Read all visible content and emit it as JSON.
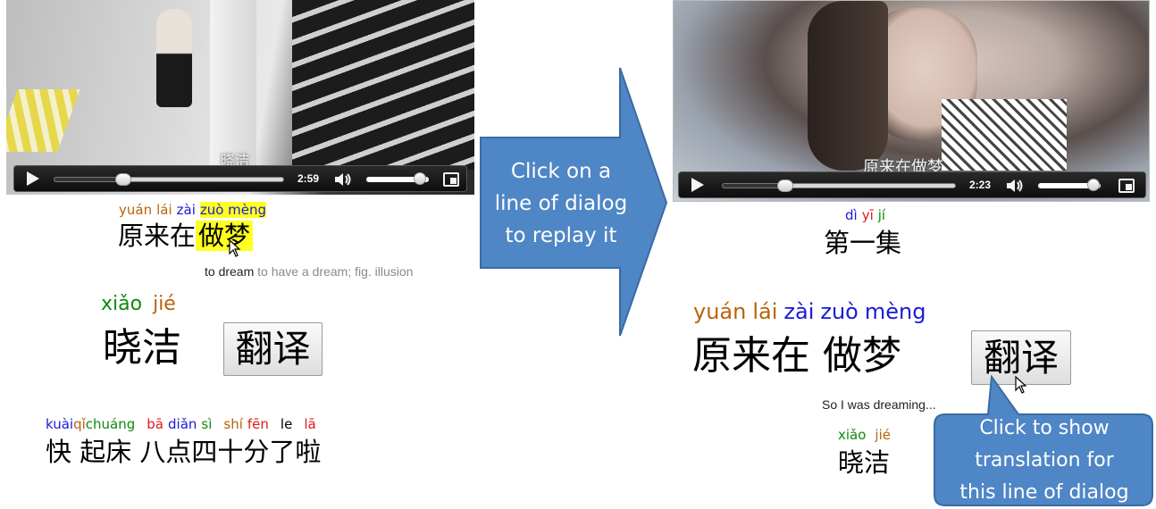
{
  "colors": {
    "pinyin_tone_1": "#b8640a",
    "pinyin_tone_2": "#0e8a0e",
    "pinyin_tone_3": "#1a1ad8",
    "pinyin_tone_4": "#e01818",
    "highlight": "#ffff22",
    "callout_fill": "#4f86c6",
    "callout_stroke": "#3a6ba3"
  },
  "left_panel": {
    "video": {
      "subtitle": "晓洁",
      "time": "2:59",
      "progress": 0.3,
      "volume": 0.85,
      "icons": [
        "play-icon",
        "volume-icon",
        "fullscreen-icon"
      ]
    },
    "line1": {
      "pinyin": [
        "yuán",
        "lái",
        "zài",
        "zuò mèng"
      ],
      "hanzi": [
        "原来在",
        "做梦"
      ],
      "highlighted_word": "做梦",
      "gloss_word": "to dream",
      "gloss_rest": "to have a dream; fig. illusion"
    },
    "line2": {
      "pinyin": [
        "xiǎo",
        "jié"
      ],
      "hanzi": "晓洁",
      "translate_button": "翻译"
    },
    "line3": {
      "pinyin": [
        "kuài",
        "qǐ",
        "chuáng",
        "bā",
        "diǎn",
        "sì",
        "shí",
        "fēn",
        "le",
        "lā"
      ],
      "hanzi": "快 起床 八点四十分了啦"
    }
  },
  "arrow_callout": {
    "text_line1": "Click on a",
    "text_line2": "line of dialog",
    "text_line3": "to replay it"
  },
  "right_panel": {
    "video": {
      "subtitle": "原来在做梦",
      "time": "2:23",
      "progress": 0.27,
      "volume": 0.88,
      "icons": [
        "play-icon",
        "volume-icon",
        "fullscreen-icon"
      ]
    },
    "episode": {
      "pinyin": [
        "dì",
        "yī",
        "jí"
      ],
      "hanzi": "第一集"
    },
    "line1": {
      "pinyin": [
        "yuán",
        "lái",
        "zài",
        "zuò",
        "mèng"
      ],
      "hanzi": "原来在 做梦",
      "translate_button": "翻译",
      "translation": "So I was dreaming..."
    },
    "line2": {
      "pinyin": [
        "xiǎo",
        "jié"
      ],
      "hanzi": "晓洁"
    }
  },
  "bubble_callout": {
    "text_line1": "Click to show",
    "text_line2": "translation for",
    "text_line3": "this line of dialog"
  }
}
